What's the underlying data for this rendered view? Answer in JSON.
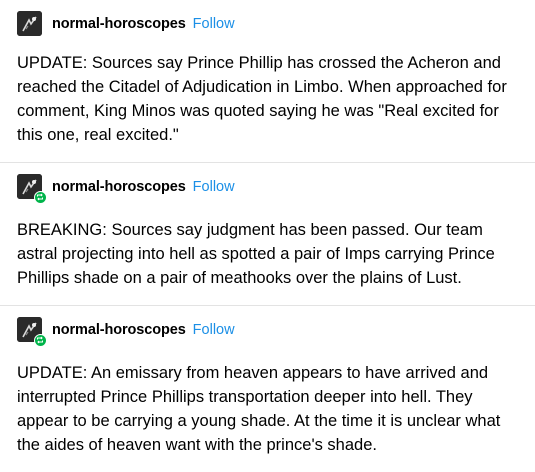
{
  "posts": [
    {
      "username": "normal-horoscopes",
      "follow_label": "Follow",
      "avatar_icon": "avatar-image",
      "reblogged": false,
      "text": "UPDATE: Sources say Prince Phillip has crossed the Acheron and reached the Citadel of Adjudication in Limbo. When approached for comment, King Minos was quoted saying he was \"Real excited for this one, real excited.\""
    },
    {
      "username": "normal-horoscopes",
      "follow_label": "Follow",
      "avatar_icon": "avatar-image",
      "reblogged": true,
      "text": "BREAKING: Sources say judgment has been passed. Our team astral projecting into hell as spotted a pair of Imps carrying Prince Phillips shade on a pair of meathooks over the plains of Lust."
    },
    {
      "username": "normal-horoscopes",
      "follow_label": "Follow",
      "avatar_icon": "avatar-image",
      "reblogged": true,
      "text": "UPDATE: An emissary from heaven appears to have arrived and interrupted Prince Phillips transportation deeper into hell. They appear to be carrying a young shade. At the time it is unclear what the aides of heaven want with the prince's shade."
    }
  ],
  "colors": {
    "follow": "#1b8fe6",
    "reblog_badge": "#00b44a",
    "divider": "#e3e3e3"
  }
}
